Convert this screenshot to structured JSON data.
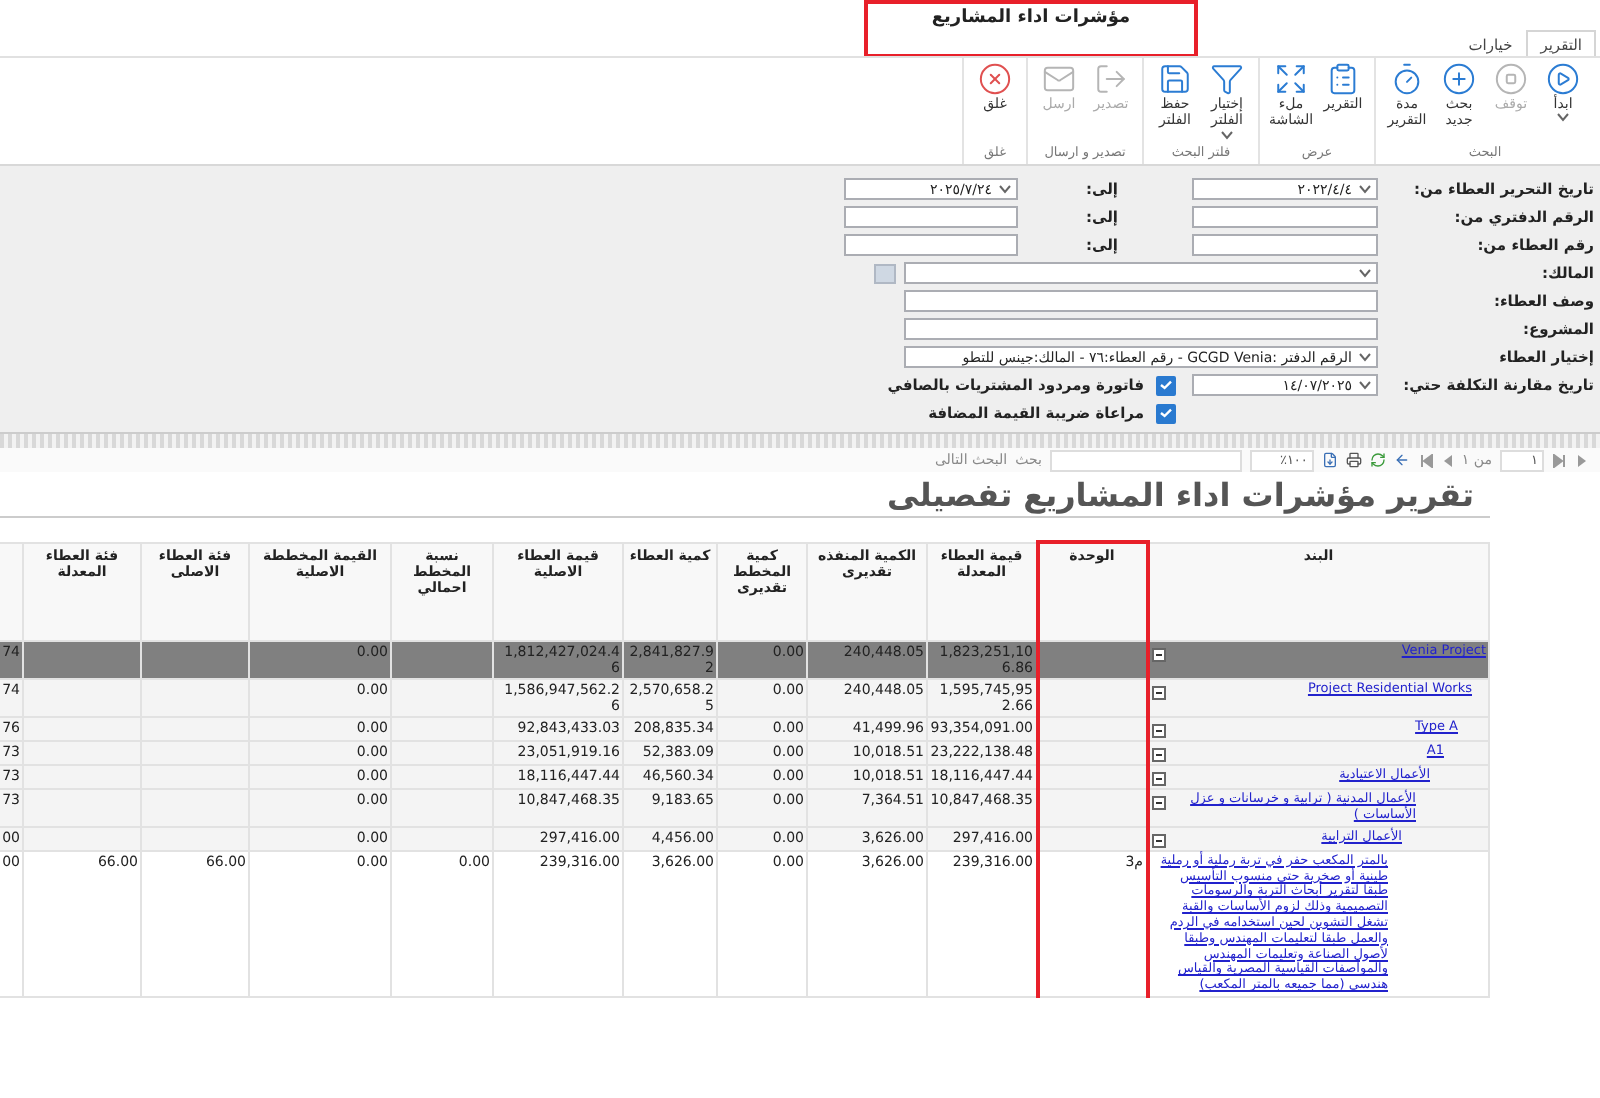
{
  "window": {
    "title": "مؤشرات اداء المشاريع",
    "highlighted": true
  },
  "ribbon": {
    "tabs": [
      {
        "label": "التقرير",
        "selected": true
      },
      {
        "label": "خيارات",
        "selected": false
      }
    ],
    "groups": [
      {
        "label": "البحث",
        "buttons": [
          {
            "label": "ابدأ",
            "disabled": false,
            "dropdown": true
          },
          {
            "label": "توقف",
            "disabled": true,
            "dropdown": false
          },
          {
            "label": "بحث جديد",
            "disabled": false,
            "dropdown": false
          },
          {
            "label": "مدة التقرير",
            "disabled": false,
            "dropdown": false
          }
        ]
      },
      {
        "label": "عرض",
        "buttons": [
          {
            "label": "التقرير",
            "disabled": false,
            "dropdown": false
          },
          {
            "label": "ملء الشاشة",
            "disabled": false,
            "dropdown": false
          }
        ]
      },
      {
        "label": "فلتر البحث",
        "buttons": [
          {
            "label": "إختيار الفلتر",
            "disabled": false,
            "dropdown": true
          },
          {
            "label": "حفظ الفلتر",
            "disabled": false,
            "dropdown": false
          }
        ]
      },
      {
        "label": "تصدير و ارسال",
        "buttons": [
          {
            "label": "تصدير",
            "disabled": true,
            "dropdown": false
          },
          {
            "label": "ارسل",
            "disabled": true,
            "dropdown": false
          }
        ]
      },
      {
        "label": "غلق",
        "buttons": [
          {
            "label": "غلق",
            "disabled": false,
            "dropdown": false
          }
        ]
      }
    ]
  },
  "filters": {
    "rows": [
      {
        "kind": "range",
        "label": "تاريخ التحرير العطاء من:",
        "from": {
          "value": "٢٠٢٢/٤/٤",
          "dropdown": true
        },
        "to_label": "إلى:",
        "to": {
          "value": "٢٠٢٥/٧/٢٤",
          "dropdown": true
        }
      },
      {
        "kind": "range",
        "label": "الرقم الدفتري من:",
        "from": {
          "dropdown": false
        },
        "to_label": "إلى:",
        "to": {
          "dropdown": false
        }
      },
      {
        "kind": "range",
        "label": "رقم العطاء من:",
        "from": {
          "dropdown": false
        },
        "to_label": "إلى:",
        "to": {
          "dropdown": false
        }
      },
      {
        "kind": "wide",
        "label": "المالك:",
        "dropdown": true,
        "side_button": true
      },
      {
        "kind": "wide",
        "label": "وصف العطاء:",
        "dropdown": false
      },
      {
        "kind": "wide",
        "label": "المشروع:",
        "dropdown": false
      },
      {
        "kind": "wide",
        "label": "إختيار العطاء",
        "value": "الرقم الدفتر :GCGD Venia  - رقم العطاء:٧٦  - المالك:جينس للتطو",
        "dropdown": true
      },
      {
        "kind": "date_check",
        "label": "تاريخ مقارنة التكلفة حتي:",
        "value": "١٤/٠٧/٢٠٢٥",
        "dropdown": true,
        "check": {
          "label": "فاتورة ومردود المشتريات بالصافي",
          "checked": true
        }
      },
      {
        "kind": "check",
        "check": {
          "label": "مراعاة ضريبة القيمة المضافة",
          "checked": true
        }
      }
    ]
  },
  "report_toolbar": {
    "page": "١",
    "page_count": "من ١",
    "zoom": "١٠٠٪",
    "search_button": "بحث",
    "find_next": "البحث التالى"
  },
  "report": {
    "title": "تقرير مؤشرات اداء المشاريع تفصيلى",
    "tree_column": {
      "label": "البند",
      "highlighted": false
    },
    "columns": [
      {
        "label": "الوحدة",
        "highlighted": true
      },
      {
        "label": "قيمة العطاء المعدلة",
        "highlighted": false
      },
      {
        "label": "الكمية المنفذه تقديرى",
        "highlighted": false
      },
      {
        "label": "كمية المخطط تقديرى",
        "highlighted": false
      },
      {
        "label": "كمية العطاء",
        "highlighted": false
      },
      {
        "label": "قيمة العطاء الاصلية",
        "highlighted": false
      },
      {
        "label": "نسبة المخطط احمالي",
        "highlighted": false
      },
      {
        "label": "القيمة المخططة الاصلية",
        "highlighted": false
      },
      {
        "label": "فئة العطاء الاصلى",
        "highlighted": false
      },
      {
        "label": "فئة العطاء المعدلة",
        "highlighted": false
      },
      {
        "highlighted": false
      }
    ],
    "rows": [
      {
        "label": "Venia Project",
        "selected": true,
        "expanded": true,
        "cells": [
          null,
          "1,823,251,106.86",
          "240,448.05",
          "0.00",
          "2,841,827.92",
          "1,812,427,024.46",
          null,
          "0.00",
          null,
          null,
          "74"
        ],
        "children": [
          {
            "label": "Project Residential Works",
            "selected": false,
            "expanded": true,
            "cells": [
              null,
              "1,595,745,952.66",
              "240,448.05",
              "0.00",
              "2,570,658.25",
              "1,586,947,562.26",
              null,
              "0.00",
              null,
              null,
              "74"
            ],
            "children": [
              {
                "label": "Type A",
                "selected": false,
                "expanded": true,
                "cells": [
                  null,
                  "93,354,091.00",
                  "41,499.96",
                  "0.00",
                  "208,835.34",
                  "92,843,433.03",
                  null,
                  "0.00",
                  null,
                  null,
                  "76"
                ],
                "children": [
                  {
                    "label": "A1",
                    "selected": false,
                    "expanded": true,
                    "cells": [
                      null,
                      "23,222,138.48",
                      "10,018.51",
                      "0.00",
                      "52,383.09",
                      "23,051,919.16",
                      null,
                      "0.00",
                      null,
                      null,
                      "73"
                    ],
                    "children": [
                      {
                        "label": "الأعمال الاعتيادية",
                        "selected": false,
                        "expanded": true,
                        "cells": [
                          null,
                          "18,116,447.44",
                          "10,018.51",
                          "0.00",
                          "46,560.34",
                          "18,116,447.44",
                          null,
                          "0.00",
                          null,
                          null,
                          "73"
                        ],
                        "children": [
                          {
                            "label": "الأعمال المدنية ( ترابية و خرسانات و عزل الأساسات )",
                            "selected": false,
                            "expanded": true,
                            "cells": [
                              null,
                              "10,847,468.35",
                              "7,364.51",
                              "0.00",
                              "9,183.65",
                              "10,847,468.35",
                              null,
                              "0.00",
                              null,
                              null,
                              "73"
                            ],
                            "children": [
                              {
                                "label": "الأعمال الترابية",
                                "selected": false,
                                "expanded": true,
                                "cells": [
                                  null,
                                  "297,416.00",
                                  "3,626.00",
                                  "0.00",
                                  "4,456.00",
                                  "297,416.00",
                                  null,
                                  "0.00",
                                  null,
                                  null,
                                  "00"
                                ],
                                "children": [
                                  {
                                    "label": "بالمتر المكعب حفر في تربة رملية أو رملية طينية أو صخرية حتى منسوب التأسيس طبقا لتقرير أبحاث التربة والرسومات التصميمية وذلك لزوم الأساسات والقبة تشغل التشوين لحين استخدامه في الردم والعمل طبقا لتعليمات المهندس وطبقا لأصول الصناعة وتعليمات المهندس والمواصفات القياسية المصرية والقياس هندسي (مما جميعه بالمتر المكعب)",
                                    "selected": false,
                                    "cells": [
                                      "م3",
                                      "239,316.00",
                                      "3,626.00",
                                      "0.00",
                                      "3,626.00",
                                      "239,316.00",
                                      "0.00",
                                      "0.00",
                                      "66.00",
                                      "66.00",
                                      "00"
                                    ]
                                  }
                                ]
                              }
                            ]
                          }
                        ]
                      }
                    ]
                  }
                ]
              }
            ]
          }
        ]
      }
    ]
  }
}
